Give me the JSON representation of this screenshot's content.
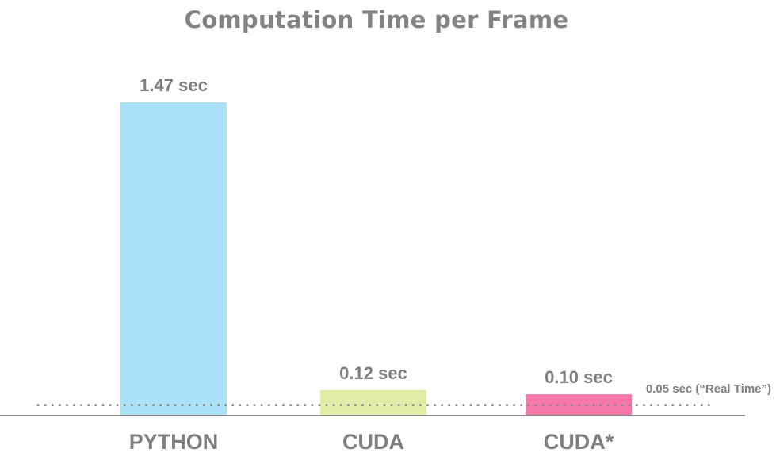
{
  "chart_data": {
    "type": "bar",
    "title": "Computation Time per Frame",
    "xlabel": "",
    "ylabel": "",
    "ylim": [
      0,
      1.6
    ],
    "categories": [
      "PYTHON",
      "CUDA",
      "CUDA*"
    ],
    "values": [
      1.47,
      0.12,
      0.1
    ],
    "value_labels": [
      "1.47 sec",
      "0.12 sec",
      "0.10 sec"
    ],
    "colors": [
      "#a9e1f8",
      "#e0eda7",
      "#f577a8"
    ],
    "reference_line": {
      "value": 0.05,
      "label": "0.05 sec (“Real Time”)",
      "style": "dotted",
      "color": "#8c8c8c"
    },
    "axis_color": "#8c8c8c",
    "text_color": "#7f7f7f",
    "grid": false,
    "legend": "none"
  }
}
